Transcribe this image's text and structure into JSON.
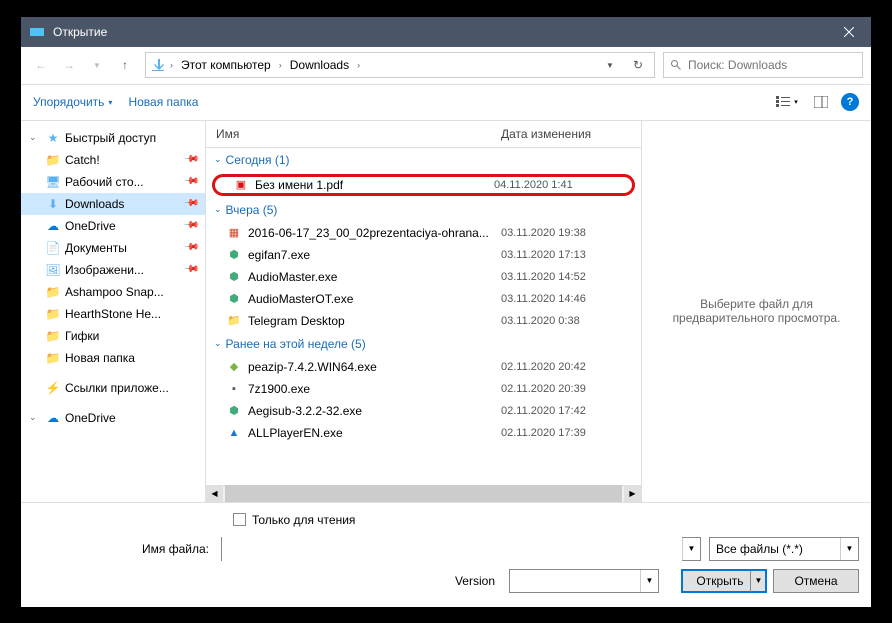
{
  "title": "Открытие",
  "breadcrumb": {
    "root": "Этот компьютер",
    "folder": "Downloads"
  },
  "search_placeholder": "Поиск: Downloads",
  "toolbar": {
    "organize": "Упорядочить",
    "newfolder": "Новая папка"
  },
  "sidebar": {
    "quick": "Быстрый доступ",
    "items": [
      {
        "label": "Catch!"
      },
      {
        "label": "Рабочий сто..."
      },
      {
        "label": "Downloads"
      },
      {
        "label": "OneDrive"
      },
      {
        "label": "Документы"
      },
      {
        "label": "Изображени..."
      },
      {
        "label": "Ashampoo Snap..."
      },
      {
        "label": "HearthStone  He..."
      },
      {
        "label": "Гифки"
      },
      {
        "label": "Новая папка"
      }
    ],
    "links": "Ссылки приложе...",
    "onedrive": "OneDrive"
  },
  "columns": {
    "name": "Имя",
    "date": "Дата изменения"
  },
  "groups": [
    {
      "title": "Сегодня (1)",
      "files": [
        {
          "name": "Без имени 1.pdf",
          "date": "04.11.2020 1:41",
          "icon": "pdf",
          "hl": true
        }
      ]
    },
    {
      "title": "Вчера (5)",
      "files": [
        {
          "name": "2016-06-17_23_00_02prezentaciya-ohrana...",
          "date": "03.11.2020 19:38",
          "icon": "ppt"
        },
        {
          "name": "egifan7.exe",
          "date": "03.11.2020 17:13",
          "icon": "exe"
        },
        {
          "name": "AudioMaster.exe",
          "date": "03.11.2020 14:52",
          "icon": "exe"
        },
        {
          "name": "AudioMasterOT.exe",
          "date": "03.11.2020 14:46",
          "icon": "exe"
        },
        {
          "name": "Telegram Desktop",
          "date": "03.11.2020 0:38",
          "icon": "folder"
        }
      ]
    },
    {
      "title": "Ранее на этой неделе (5)",
      "files": [
        {
          "name": "peazip-7.4.2.WIN64.exe",
          "date": "02.11.2020 20:42",
          "icon": "pea"
        },
        {
          "name": "7z1900.exe",
          "date": "02.11.2020 20:39",
          "icon": "7z"
        },
        {
          "name": "Aegisub-3.2.2-32.exe",
          "date": "02.11.2020 17:42",
          "icon": "exe"
        },
        {
          "name": "ALLPlayerEN.exe",
          "date": "02.11.2020 17:39",
          "icon": "all"
        }
      ]
    }
  ],
  "preview": "Выберите файл для предварительного просмотра.",
  "readonly": "Только для чтения",
  "filename_label": "Имя файла:",
  "version_label": "Version",
  "filetype": "Все файлы (*.*)",
  "open_btn": "Открыть",
  "cancel_btn": "Отмена"
}
